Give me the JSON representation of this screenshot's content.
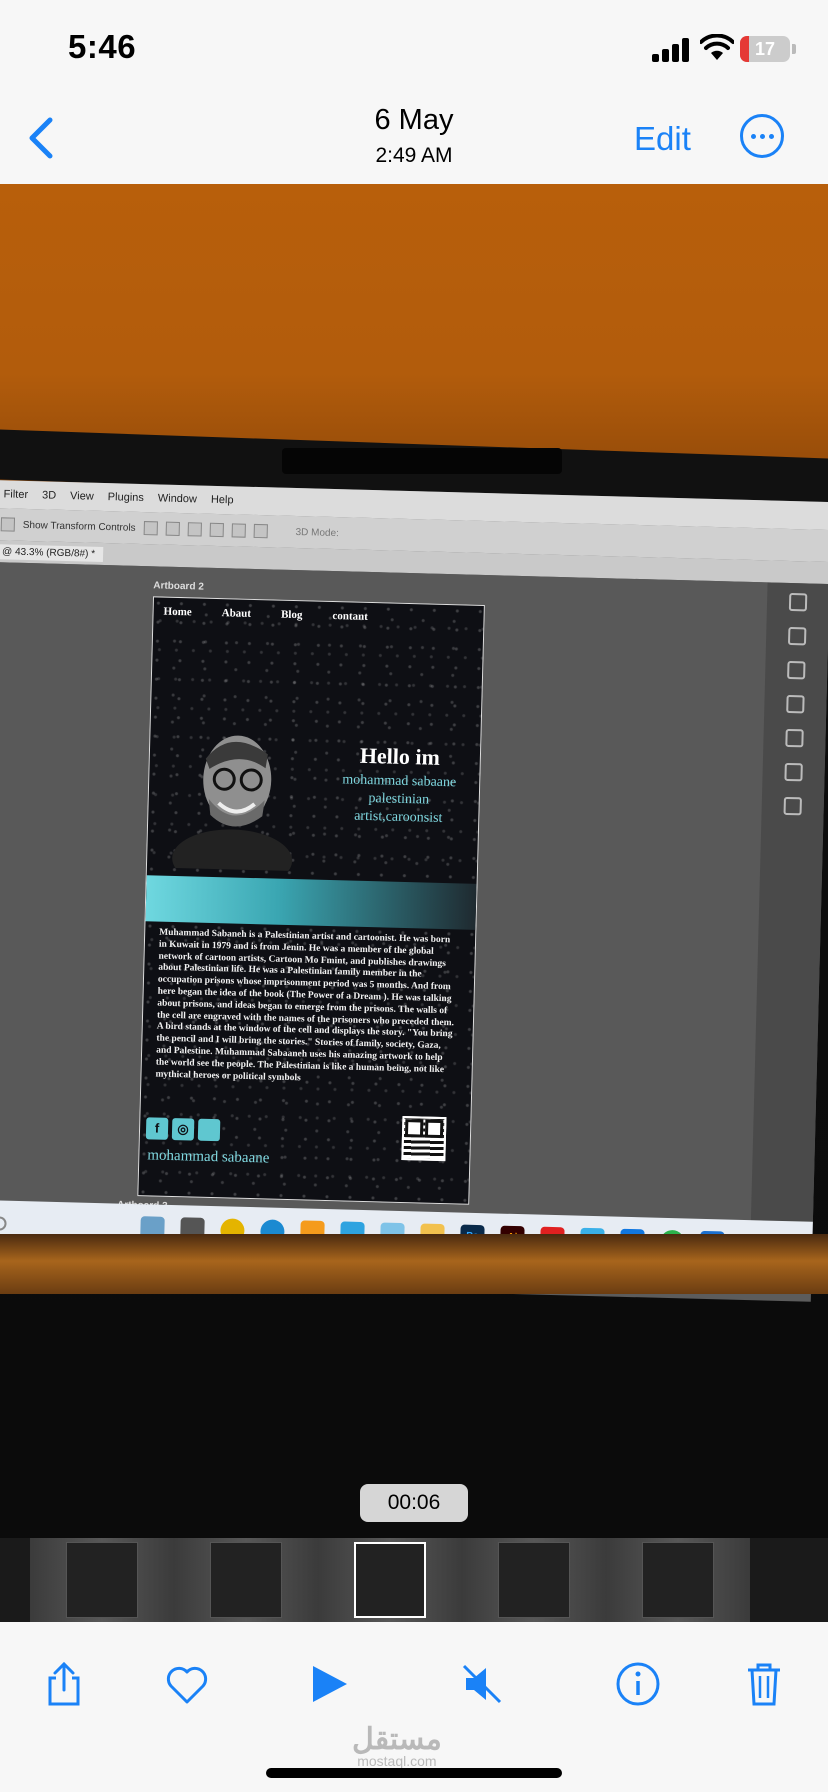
{
  "status_bar": {
    "time": "5:46",
    "battery": "17",
    "battery_level": 0.17
  },
  "nav": {
    "date": "6 May",
    "time": "2:49 AM",
    "edit_label": "Edit"
  },
  "photoshop": {
    "menu": [
      "Filter",
      "3D",
      "View",
      "Plugins",
      "Window",
      "Help"
    ],
    "options_label": "Show Transform Controls",
    "mode_label": "3D Mode:",
    "doc_tab": "@ 43.3% (RGB/8#) *",
    "artboard_label": "Artboard 2",
    "artboard_next_label": "Artboard 3"
  },
  "artboard": {
    "nav": [
      "Home",
      "Abaut",
      "Blog",
      "contant"
    ],
    "hero": [
      "Hello im",
      "mohammad sabaane",
      "palestinian",
      "artist,caroonsist"
    ],
    "bio": "Muhammad Sabaneh is a Palestinian artist and cartoonist. He was born in Kuwait in 1979 and is from Jenin. He was a member of the global network of cartoon artists, Cartoon Mo Fmint, and publishes drawings about Palestinian life. He was a Palestinian family member in the occupation prisons whose imprisonment period was 5 months. And from here began the idea of the book (The Power of a Dream ). He was talking about prisons, and ideas began to emerge from the prisons. The walls of the cell are engraved with the names of the prisoners who preceded them. A bird stands at the window of the cell and displays the story. \"You bring the pencil and I will bring the stories.\" Stories of family, society, Gaza, and Palestine. Muhammad Sabaaneh uses his amazing artwork to help the world see the people. The Palestinian is like a human being, not like mythical heroes or political symbols",
    "signature": "mohammad sabaane",
    "socials": [
      "facebook-icon",
      "instagram-icon",
      "twitter-icon"
    ]
  },
  "taskbar": {
    "search_placeholder": "Search",
    "apps": [
      "Ps",
      "Ai"
    ]
  },
  "video": {
    "elapsed": "00:06"
  },
  "toolbar": {
    "actions": [
      "share-icon",
      "favorite-icon",
      "play-icon",
      "mute-icon",
      "info-icon",
      "delete-icon"
    ]
  },
  "watermark": {
    "arabic": "مستقل",
    "latin": "mostaql.com"
  },
  "colors": {
    "ios_blue": "#1a82f7",
    "accent_teal": "#7fd7df",
    "battery_red": "#e53935"
  }
}
